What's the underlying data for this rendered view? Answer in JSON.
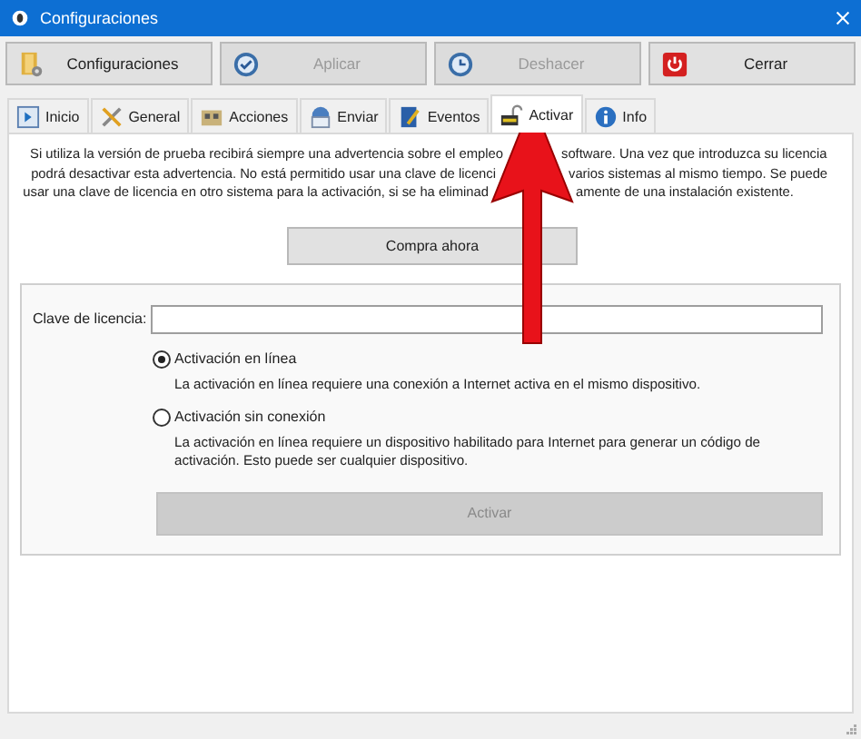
{
  "window": {
    "title": "Configuraciones"
  },
  "toolbar": [
    {
      "label": "Configuraciones",
      "kind": "settings",
      "disabled": false
    },
    {
      "label": "Aplicar",
      "kind": "apply",
      "disabled": true
    },
    {
      "label": "Deshacer",
      "kind": "undo",
      "disabled": true
    },
    {
      "label": "Cerrar",
      "kind": "power",
      "disabled": false
    }
  ],
  "tabs": [
    {
      "label": "Inicio",
      "kind": "start",
      "selected": false
    },
    {
      "label": "General",
      "kind": "tools",
      "selected": false
    },
    {
      "label": "Acciones",
      "kind": "actions",
      "selected": false
    },
    {
      "label": "Enviar",
      "kind": "send",
      "selected": false
    },
    {
      "label": "Eventos",
      "kind": "events",
      "selected": false
    },
    {
      "label": "Activar",
      "kind": "lock",
      "selected": true
    },
    {
      "label": "Info",
      "kind": "info",
      "selected": false
    }
  ],
  "intro_lines": [
    {
      "left": "Si utiliza la versión de prueba recibirá siempre una advertencia sobre el empleo",
      "right": "software. Una vez que introduzca su licencia"
    },
    {
      "left": "podrá desactivar esta advertencia. No está permitido usar una clave de licenci",
      "right": "varios sistemas al mismo tiempo. Se puede"
    },
    {
      "left": "usar una clave de licencia en otro sistema para la activación, si se ha eliminad",
      "right": "amente de una instalación existente."
    }
  ],
  "buy_button": {
    "label": "Compra ahora"
  },
  "license": {
    "label": "Clave de licencia:"
  },
  "options": [
    {
      "label": "Activación en línea",
      "description": "La activación en línea requiere una conexión a Internet activa en el mismo dispositivo.",
      "selected": true
    },
    {
      "label": "Activación sin conexión",
      "description": "La activación en línea requiere un dispositivo habilitado para Internet para generar un código de activación. Esto puede ser cualquier dispositivo.",
      "selected": false
    }
  ],
  "activate_button": {
    "label": "Activar",
    "disabled": true
  }
}
